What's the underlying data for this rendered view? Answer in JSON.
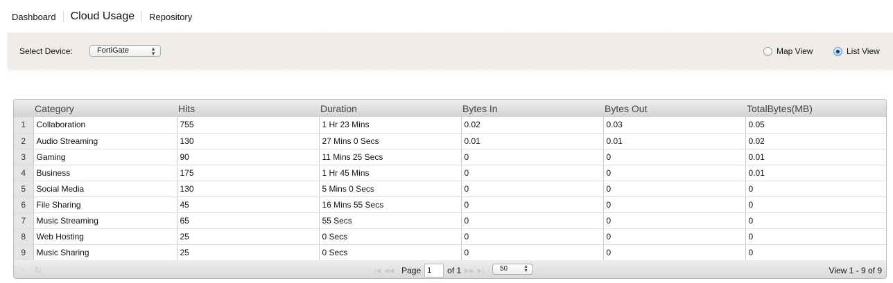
{
  "nav": {
    "items": [
      "Dashboard",
      "Cloud Usage",
      "Repository"
    ]
  },
  "toolbar": {
    "select_label": "Select Device:",
    "device": "FortiGate",
    "map_view": "Map View",
    "list_view": "List View",
    "selected_view": "List View"
  },
  "table": {
    "columns": [
      "Category",
      "Hits",
      "Duration",
      "Bytes In",
      "Bytes Out",
      "TotalBytes(MB)"
    ],
    "rows": [
      [
        "1",
        "Collaboration",
        "755",
        "1 Hr 23 Mins",
        "0.02",
        "0.03",
        "0.05"
      ],
      [
        "2",
        "Audio Streaming",
        "130",
        "27 Mins 0 Secs",
        "0.01",
        "0.01",
        "0.02"
      ],
      [
        "3",
        "Gaming",
        "90",
        "11 Mins 25 Secs",
        "0",
        "0",
        "0.01"
      ],
      [
        "4",
        "Business",
        "175",
        "1 Hr 45 Mins",
        "0",
        "0",
        "0.01"
      ],
      [
        "5",
        "Social Media",
        "130",
        "5 Mins 0 Secs",
        "0",
        "0",
        "0"
      ],
      [
        "6",
        "File Sharing",
        "45",
        "16 Mins 55 Secs",
        "0",
        "0",
        "0"
      ],
      [
        "7",
        "Music Streaming",
        "65",
        "55 Secs",
        "0",
        "0",
        "0"
      ],
      [
        "8",
        "Web Hosting",
        "25",
        "0 Secs",
        "0",
        "0",
        "0"
      ],
      [
        "9",
        "Music Sharing",
        "25",
        "0 Secs",
        "0",
        "0",
        "0"
      ]
    ]
  },
  "footer": {
    "page_label": "Page",
    "page": "1",
    "of_label": "of 1",
    "page_size": "50",
    "view_text": "View 1 - 9 of 9"
  }
}
